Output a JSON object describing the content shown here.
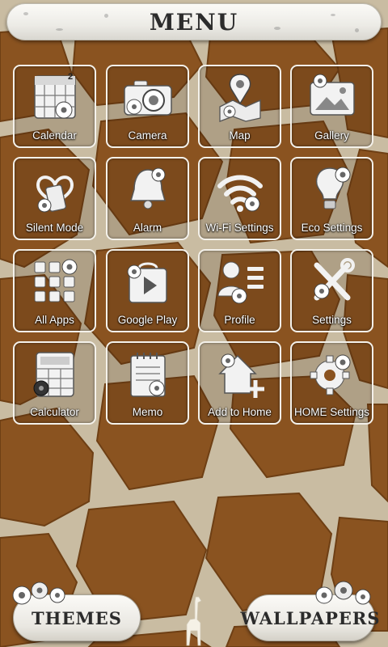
{
  "header": {
    "title": "MENU"
  },
  "tiles": [
    {
      "label": "Calendar",
      "badge": "2",
      "icon": "calendar-icon"
    },
    {
      "label": "Camera",
      "icon": "camera-icon"
    },
    {
      "label": "Map",
      "icon": "map-icon"
    },
    {
      "label": "Gallery",
      "icon": "gallery-icon"
    },
    {
      "label": "Silent Mode",
      "icon": "silent-mode-icon"
    },
    {
      "label": "Alarm",
      "icon": "alarm-bell-icon"
    },
    {
      "label": "Wi-Fi Settings",
      "icon": "wifi-icon"
    },
    {
      "label": "Eco Settings",
      "icon": "eco-bulb-icon"
    },
    {
      "label": "All Apps",
      "icon": "all-apps-icon"
    },
    {
      "label": "Google Play",
      "icon": "google-play-icon"
    },
    {
      "label": "Profile",
      "icon": "profile-icon"
    },
    {
      "label": "Settings",
      "icon": "settings-tools-icon"
    },
    {
      "label": "Calculator",
      "icon": "calculator-icon"
    },
    {
      "label": "Memo",
      "icon": "memo-icon"
    },
    {
      "label": "Add to Home",
      "icon": "add-to-home-icon"
    },
    {
      "label": "HOME Settings",
      "icon": "home-settings-gear-icon"
    }
  ],
  "bottom": {
    "themes_label": "THEMES",
    "wallpapers_label": "WALLPAPERS",
    "center_icon": "giraffe-icon"
  },
  "colors": {
    "fur_brown": "#8a5320",
    "fur_light": "#c9bca2",
    "tile_border": "#f4f1ea"
  }
}
